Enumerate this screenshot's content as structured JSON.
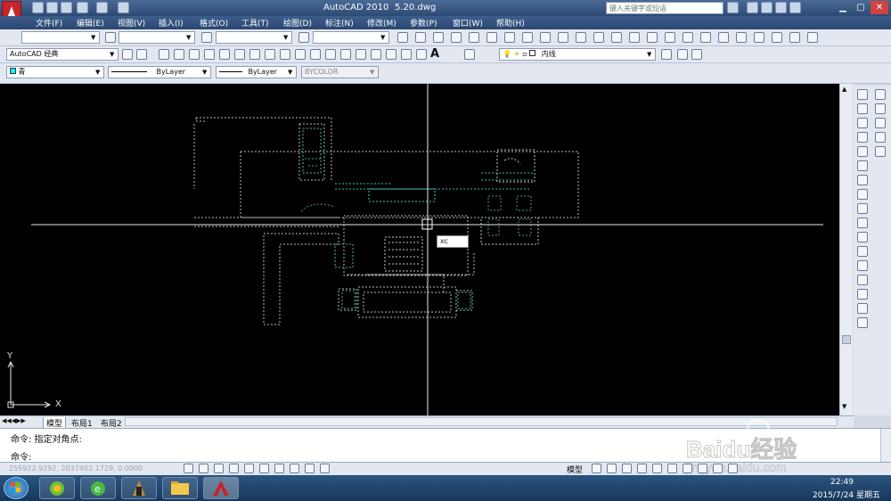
{
  "app": {
    "title": "AutoCAD 2010",
    "filename": "5.20.dwg",
    "search_placeholder": "键入关键字或短语"
  },
  "menu": [
    "文件(F)",
    "编辑(E)",
    "视图(V)",
    "插入(I)",
    "格式(O)",
    "工具(T)",
    "绘图(D)",
    "标注(N)",
    "修改(M)",
    "参数(P)",
    "窗口(W)",
    "帮助(H)"
  ],
  "toolbar": {
    "workspace": "AutoCAD 经典",
    "layer_current": "内线",
    "color_current": "青",
    "linetype": "ByLayer",
    "lineweight": "ByLayer",
    "plotstyle": "BYCOLOR"
  },
  "canvas": {
    "crosshair_label": "xc",
    "ucs_x": "X",
    "ucs_y": "Y"
  },
  "layout_tabs": [
    "模型",
    "布局1",
    "布局2"
  ],
  "command": {
    "history": "命令: 指定对角点:",
    "prompt": "命令:"
  },
  "status": {
    "coordinates": "255922.9292, 2037402.1729, 0.0000",
    "model_label": "模型"
  },
  "taskbar": {
    "time": "22:49",
    "date": "2015/7/24 星期五"
  },
  "watermark": "Baidu经验",
  "watermark_url": "jingyan.baidu.com"
}
